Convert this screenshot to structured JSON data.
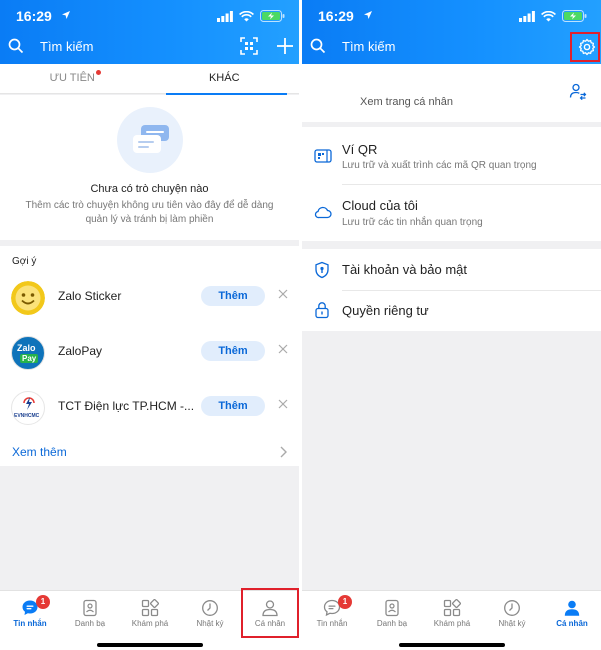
{
  "status": {
    "time": "16:29"
  },
  "colors": {
    "accent": "#0a7cf5",
    "badge": "#e53935",
    "highlight": "#e0202b"
  },
  "left": {
    "search_placeholder": "Tìm kiếm",
    "tabs": [
      {
        "label": "ƯU TIÊN"
      },
      {
        "label": "KHÁC"
      }
    ],
    "empty": {
      "title": "Chưa có trò chuyện nào",
      "description": "Thêm các trò chuyện không ưu tiên vào đây để dễ dàng quản lý và tránh bị làm phiền"
    },
    "suggestions": {
      "title": "Gợi ý",
      "items": [
        {
          "name": "Zalo Sticker",
          "action": "Thêm"
        },
        {
          "name": "ZaloPay",
          "action": "Thêm",
          "logo_line1": "Zalo",
          "logo_line2": "Pay"
        },
        {
          "name": "TCT Điện lực TP.HCM -...",
          "action": "Thêm",
          "logo_text": "EVNHCMC"
        }
      ],
      "see_more": "Xem thêm"
    }
  },
  "right": {
    "search_placeholder": "Tìm kiếm",
    "profile_link": "Xem trang cá nhân",
    "menu": [
      {
        "title": "Ví QR",
        "subtitle": "Lưu trữ và xuất trình các mã QR quan trọng"
      },
      {
        "title": "Cloud của tôi",
        "subtitle": "Lưu trữ các tin nhắn quan trọng"
      },
      {
        "title": "Tài khoản và bảo mật"
      },
      {
        "title": "Quyền riêng tư"
      }
    ]
  },
  "tabbar": {
    "items": [
      {
        "label": "Tin nhắn",
        "badge": "1"
      },
      {
        "label": "Danh bạ"
      },
      {
        "label": "Khám phá"
      },
      {
        "label": "Nhật ký"
      },
      {
        "label": "Cá nhân"
      }
    ]
  }
}
